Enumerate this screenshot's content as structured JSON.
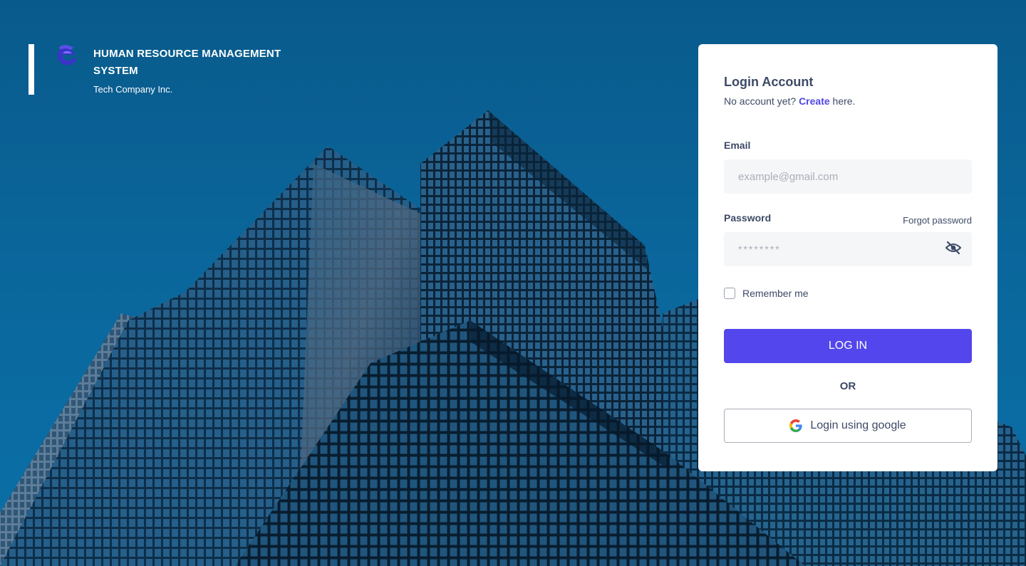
{
  "brand": {
    "title": "HUMAN RESOURCE MANAGEMENT SYSTEM",
    "subtitle": "Tech Company Inc.",
    "logo_icon": "company-logo-icon"
  },
  "login": {
    "title": "Login Account",
    "no_account_text": "No account yet?",
    "create_link": "Create",
    "create_suffix": "here.",
    "email_label": "Email",
    "email_placeholder": "example@gmail.com",
    "email_value": "",
    "password_label": "Password",
    "forgot_password": "Forgot password",
    "password_placeholder": "********",
    "password_value": "",
    "toggle_visibility_icon": "eye-slash-icon",
    "remember_label": "Remember me",
    "remember_checked": false,
    "login_button": "LOG IN",
    "or_text": "OR",
    "google_button": "Login using google",
    "google_icon": "google-icon"
  },
  "colors": {
    "primary": "#5246ec",
    "link": "#4f46e5",
    "text": "#3d4a66",
    "input_bg": "#f5f6f8",
    "background_sky": "#0e6aa0"
  }
}
